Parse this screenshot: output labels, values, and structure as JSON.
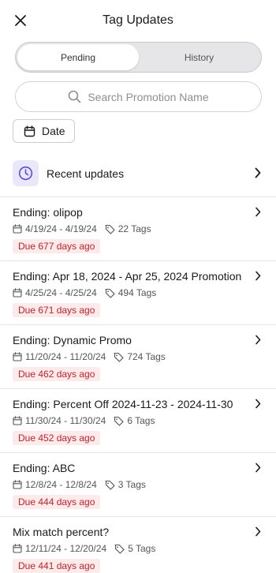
{
  "header": {
    "title": "Tag Updates"
  },
  "tabs": {
    "pending": "Pending",
    "history": "History"
  },
  "search": {
    "placeholder": "Search Promotion Name"
  },
  "filter": {
    "date_label": "Date"
  },
  "recent": {
    "label": "Recent updates"
  },
  "colors": {
    "accent": "#5b4bd6",
    "due_text": "#c0232c",
    "due_bg": "#fdeaea"
  },
  "items": [
    {
      "title": "Ending: olipop",
      "dates": "4/19/24 - 4/19/24",
      "tags": "22 Tags",
      "due": "Due 677 days ago"
    },
    {
      "title": "Ending: Apr 18, 2024 - Apr 25, 2024 Promotion",
      "dates": "4/25/24 - 4/25/24",
      "tags": "494 Tags",
      "due": "Due 671 days ago"
    },
    {
      "title": "Ending: Dynamic Promo",
      "dates": "11/20/24 - 11/20/24",
      "tags": "724 Tags",
      "due": "Due 462 days ago"
    },
    {
      "title": "Ending: Percent Off 2024-11-23 - 2024-11-30",
      "dates": "11/30/24 - 11/30/24",
      "tags": "6 Tags",
      "due": "Due 452 days ago"
    },
    {
      "title": "Ending: ABC",
      "dates": "12/8/24 - 12/8/24",
      "tags": "3 Tags",
      "due": "Due 444 days ago"
    },
    {
      "title": "Mix match percent?",
      "dates": "12/11/24 - 12/20/24",
      "tags": "5 Tags",
      "due": "Due 441 days ago"
    }
  ]
}
